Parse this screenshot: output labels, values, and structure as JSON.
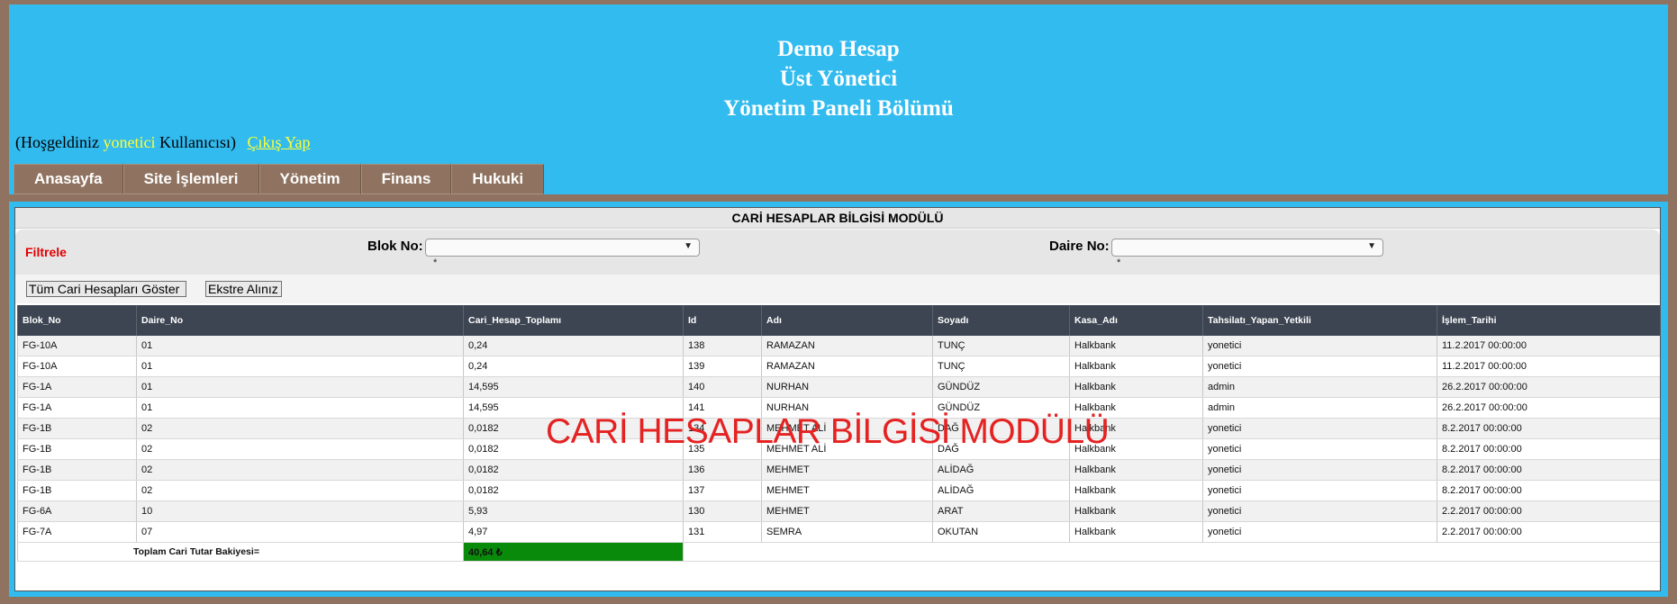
{
  "header": {
    "title_line1": "Demo Hesap",
    "title_line2": "Üst Yönetici",
    "title_line3": "Yönetim Paneli Bölümü",
    "welcome_prefix": "(Hoşgeldiniz",
    "welcome_user": "yonetici",
    "welcome_suffix": "Kullanıcısı)",
    "logout_label": "Çıkış Yap"
  },
  "nav": {
    "items": [
      "Anasayfa",
      "Site İşlemleri",
      "Yönetim",
      "Finans",
      "Hukuki"
    ]
  },
  "module": {
    "title": "CARİ HESAPLAR BİLGİSİ MODÜLÜ",
    "filter_label": "Filtrele",
    "blok_label": "Blok No:",
    "daire_label": "Daire No:",
    "required_mark": "*",
    "show_all_button": "Tüm Cari Hesapları Göster",
    "statement_button": "Ekstre Alınız",
    "overlay_text": "CARİ HESAPLAR BİLGİSİ MODÜLÜ"
  },
  "table": {
    "headers": [
      "Blok_No",
      "Daire_No",
      "Cari_Hesap_Toplamı",
      "Id",
      "Adı",
      "Soyadı",
      "Kasa_Adı",
      "Tahsilatı_Yapan_Yetkili",
      "İşlem_Tarihi"
    ],
    "rows": [
      [
        "FG-10A",
        "01",
        "0,24",
        "138",
        "RAMAZAN",
        "TUNÇ",
        "Halkbank",
        "yonetici",
        "11.2.2017 00:00:00"
      ],
      [
        "FG-10A",
        "01",
        "0,24",
        "139",
        "RAMAZAN",
        "TUNÇ",
        "Halkbank",
        "yonetici",
        "11.2.2017 00:00:00"
      ],
      [
        "FG-1A",
        "01",
        "14,595",
        "140",
        "NURHAN",
        "GÜNDÜZ",
        "Halkbank",
        "admin",
        "26.2.2017 00:00:00"
      ],
      [
        "FG-1A",
        "01",
        "14,595",
        "141",
        "NURHAN",
        "GÜNDÜZ",
        "Halkbank",
        "admin",
        "26.2.2017 00:00:00"
      ],
      [
        "FG-1B",
        "02",
        "0,0182",
        "134",
        "MEHMET ALİ",
        "DAĞ",
        "Halkbank",
        "yonetici",
        "8.2.2017 00:00:00"
      ],
      [
        "FG-1B",
        "02",
        "0,0182",
        "135",
        "MEHMET ALİ",
        "DAĞ",
        "Halkbank",
        "yonetici",
        "8.2.2017 00:00:00"
      ],
      [
        "FG-1B",
        "02",
        "0,0182",
        "136",
        "MEHMET",
        "ALİDAĞ",
        "Halkbank",
        "yonetici",
        "8.2.2017 00:00:00"
      ],
      [
        "FG-1B",
        "02",
        "0,0182",
        "137",
        "MEHMET",
        "ALİDAĞ",
        "Halkbank",
        "yonetici",
        "8.2.2017 00:00:00"
      ],
      [
        "FG-6A",
        "10",
        "5,93",
        "130",
        "MEHMET",
        "ARAT",
        "Halkbank",
        "yonetici",
        "2.2.2017 00:00:00"
      ],
      [
        "FG-7A",
        "07",
        "4,97",
        "131",
        "SEMRA",
        "OKUTAN",
        "Halkbank",
        "yonetici",
        "2.2.2017 00:00:00"
      ]
    ],
    "total_label": "Toplam Cari Tutar Bakiyesi=",
    "total_value": "40,64 ₺"
  },
  "colors": {
    "header_bg": "#32bbef",
    "nav_bg": "#8f7360",
    "table_header_bg": "#3d4552",
    "total_bg": "#0a8a0a",
    "filter_text": "#e00000",
    "overlay_text": "#e52222"
  }
}
